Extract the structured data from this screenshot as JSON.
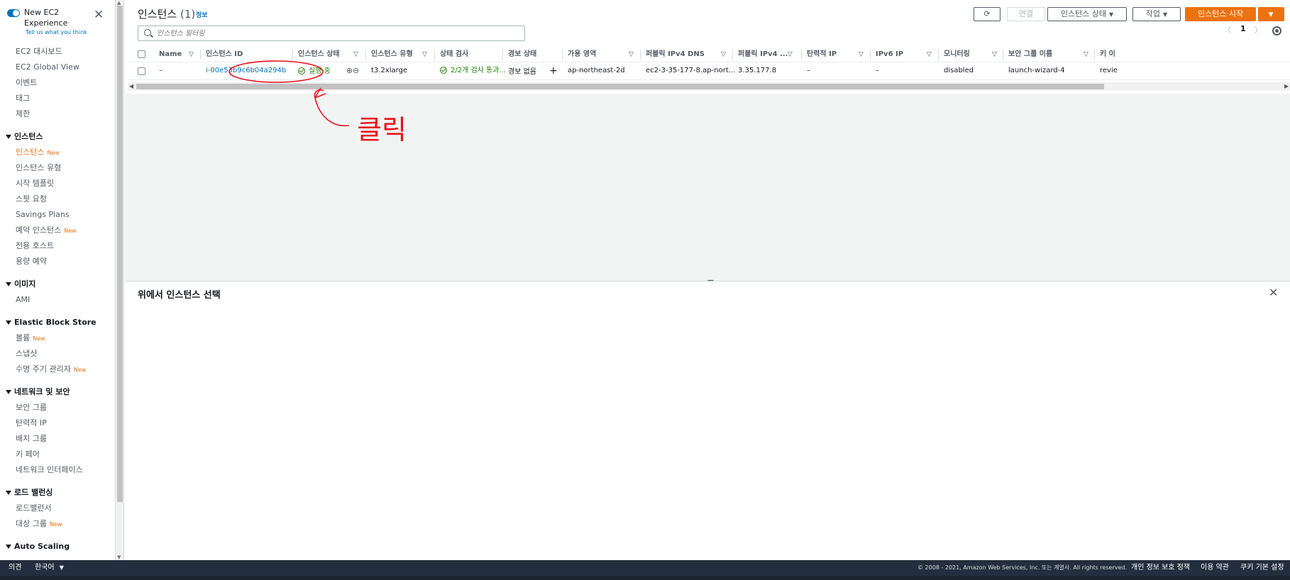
{
  "sidebar": {
    "toggle_label": "New EC2 Experience",
    "feedback_link": "Tell us what you think",
    "top_items": [
      "EC2 대시보드",
      "EC2 Global View",
      "이벤트",
      "태그",
      "제한"
    ],
    "sections": [
      {
        "title": "인스턴스",
        "items": [
          {
            "label": "인스턴스",
            "badge": "New",
            "active": true
          },
          {
            "label": "인스턴스 유형",
            "badge": ""
          },
          {
            "label": "시작 템플릿",
            "badge": ""
          },
          {
            "label": "스팟 요청",
            "badge": ""
          },
          {
            "label": "Savings Plans",
            "badge": ""
          },
          {
            "label": "예약 인스턴스",
            "badge": "New"
          },
          {
            "label": "전용 호스트",
            "badge": ""
          },
          {
            "label": "용량 예약",
            "badge": ""
          }
        ]
      },
      {
        "title": "이미지",
        "items": [
          {
            "label": "AMI",
            "badge": ""
          }
        ]
      },
      {
        "title": "Elastic Block Store",
        "items": [
          {
            "label": "볼륨",
            "badge": "New"
          },
          {
            "label": "스냅샷",
            "badge": ""
          },
          {
            "label": "수명 주기 관리자",
            "badge": "New"
          }
        ]
      },
      {
        "title": "네트워크 및 보안",
        "items": [
          {
            "label": "보안 그룹",
            "badge": ""
          },
          {
            "label": "탄력적 IP",
            "badge": ""
          },
          {
            "label": "배치 그룹",
            "badge": ""
          },
          {
            "label": "키 페어",
            "badge": ""
          },
          {
            "label": "네트워크 인터페이스",
            "badge": ""
          }
        ]
      },
      {
        "title": "로드 밸런싱",
        "items": [
          {
            "label": "로드밸런서",
            "badge": ""
          },
          {
            "label": "대상 그룹",
            "badge": "New"
          }
        ]
      },
      {
        "title": "Auto Scaling",
        "items": []
      }
    ]
  },
  "header": {
    "title": "인스턴스",
    "count": "(1)",
    "info": "정보",
    "connect": "연결",
    "instance_state": "인스턴스 상태",
    "actions": "작업",
    "launch": "인스턴스 시작",
    "search_placeholder": "인스턴스 필터링",
    "page": "1"
  },
  "table": {
    "columns": [
      "Name",
      "인스턴스 ID",
      "인스턴스 상태",
      "인스턴스 유형",
      "상태 검사",
      "경보 상태",
      "가용 영역",
      "퍼블릭 IPv4 DNS",
      "퍼블릭 IPv4 ...",
      "탄력적 IP",
      "IPv6 IP",
      "모니터링",
      "보안 그룹 이름",
      "키 이"
    ],
    "row": {
      "name": "–",
      "instance_id": "i-00e53b9c6b04a294b",
      "state": "실행 중",
      "type": "t3.2xlarge",
      "status_check": "2/2개 검사 통과...",
      "alarm": "경보 없음",
      "az": "ap-northeast-2d",
      "dns": "ec2-3-35-177-8.ap-nort...",
      "ipv4": "3.35.177.8",
      "eip": "–",
      "ipv6": "–",
      "monitoring": "disabled",
      "sg": "launch-wizard-4",
      "key": "revie"
    }
  },
  "detail": {
    "title": "위에서 인스턴스 선택"
  },
  "annotation": {
    "text": "클릭",
    "color": "#e8141c"
  },
  "footer": {
    "feedback": "의견",
    "language": "한국어",
    "copyright": "© 2008 - 2021, Amazon Web Services, Inc. 또는 계열사. All rights reserved.",
    "privacy": "개인 정보 보호 정책",
    "terms": "이용 약관",
    "cookies": "쿠키 기본 설정"
  }
}
